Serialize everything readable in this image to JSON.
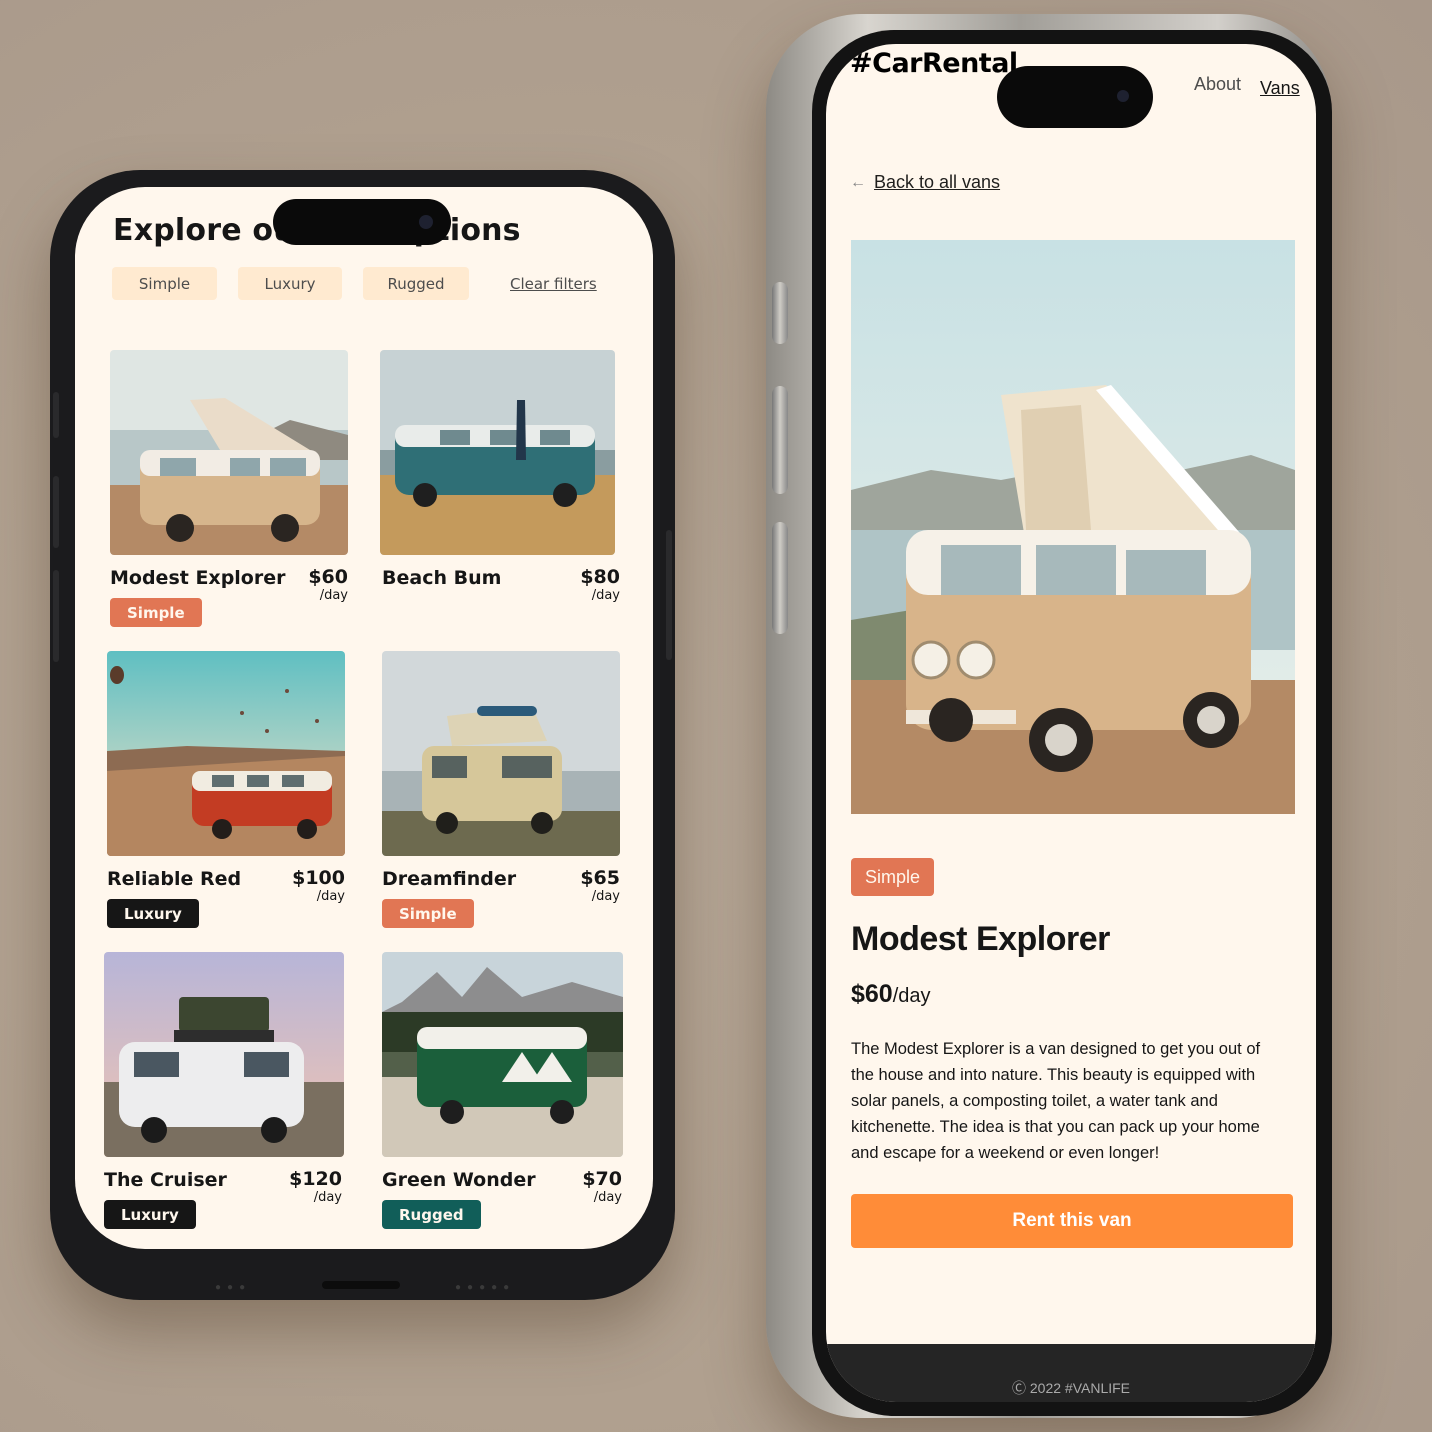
{
  "left_phone": {
    "title": "Explore our van options",
    "filters": [
      "Simple",
      "Luxury",
      "Rugged"
    ],
    "clear_filters": "Clear filters",
    "vans": [
      {
        "name": "Modest Explorer",
        "price": "$60",
        "per": "/day",
        "type": "Simple"
      },
      {
        "name": "Beach Bum",
        "price": "$80",
        "per": "/day",
        "type": ""
      },
      {
        "name": "Reliable Red",
        "price": "$100",
        "per": "/day",
        "type": "Luxury"
      },
      {
        "name": "Dreamfinder",
        "price": "$65",
        "per": "/day",
        "type": "Simple"
      },
      {
        "name": "The Cruiser",
        "price": "$120",
        "per": "/day",
        "type": "Luxury"
      },
      {
        "name": "Green Wonder",
        "price": "$70",
        "per": "/day",
        "type": "Rugged"
      }
    ]
  },
  "right_phone": {
    "logo": "#CarRental",
    "nav": {
      "about": "About",
      "vans": "Vans"
    },
    "back_link": "Back to all vans",
    "back_arrow": "←",
    "badge": "Simple",
    "name": "Modest Explorer",
    "price": "$60",
    "per": "/day",
    "description": "The Modest Explorer is a van designed to get you out of the house and into nature. This beauty is equipped with solar panels, a composting toilet, a water tank and kitchenette. The idea is that you can pack up your home and escape for a weekend or even longer!",
    "rent_button": "Rent this van",
    "footer": "Ⓒ 2022 #VANLIFE"
  },
  "colors": {
    "background": "#b0a08f",
    "screen": "#fff7ed",
    "chip": "#ffead0",
    "simple": "#e17654",
    "luxury": "#161616",
    "rugged": "#115e59",
    "rent": "#ff8c38"
  },
  "icons": {
    "back": "arrow-left-icon",
    "camera": "camera-icon"
  }
}
